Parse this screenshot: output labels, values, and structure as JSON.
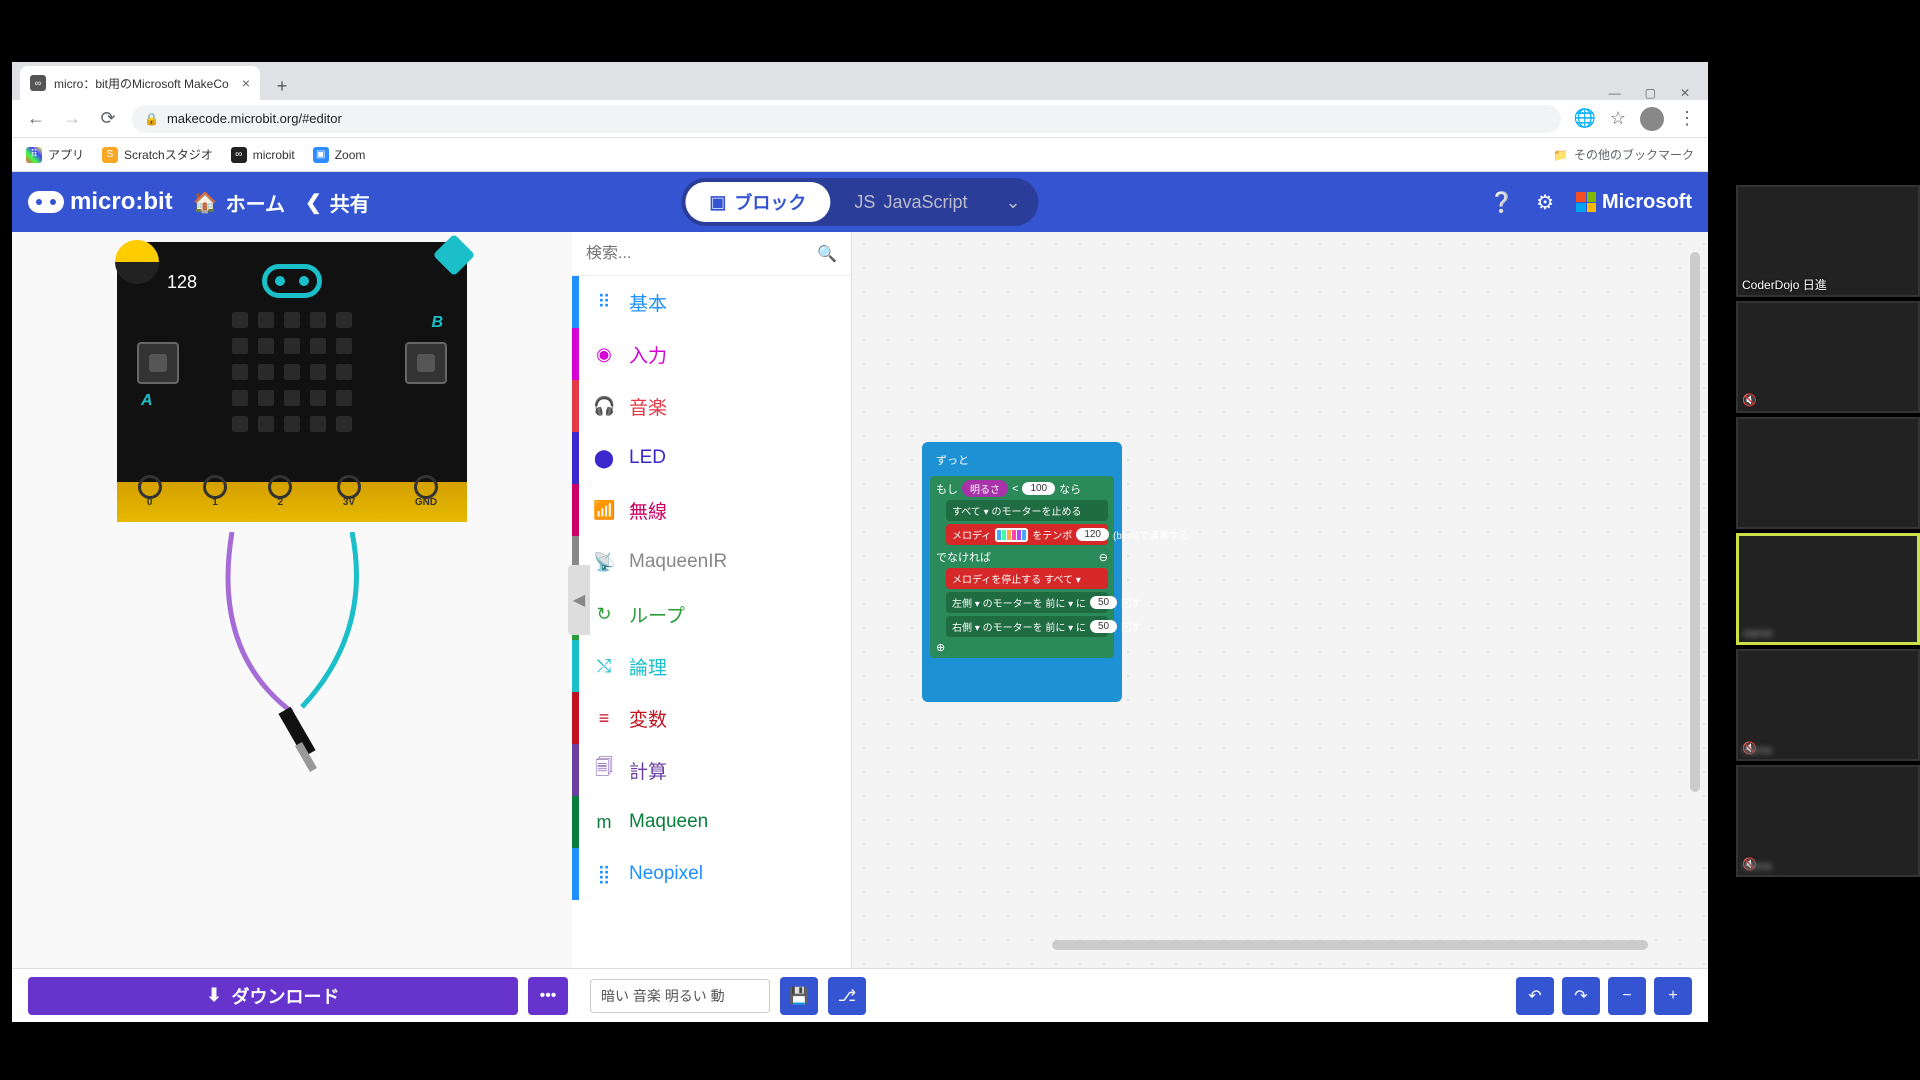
{
  "browser": {
    "tab_title": "micro：bit用のMicrosoft MakeCo",
    "url": "makecode.microbit.org/#editor",
    "bookmarks": {
      "apps": "アプリ",
      "scratch": "Scratchスタジオ",
      "microbit": "microbit",
      "zoom": "Zoom",
      "other": "その他のブックマーク"
    }
  },
  "header": {
    "logo": "micro:bit",
    "home": "ホーム",
    "share": "共有",
    "blocks": "ブロック",
    "javascript": "JavaScript",
    "ms": "Microsoft"
  },
  "sim": {
    "value": "128",
    "pins": [
      "0",
      "1",
      "2",
      "3V",
      "GND"
    ]
  },
  "search": {
    "placeholder": "検索..."
  },
  "categories": [
    {
      "label": "基本",
      "color": "#1e90ff",
      "icon": "⠿"
    },
    {
      "label": "入力",
      "color": "#d400d4",
      "icon": "◉"
    },
    {
      "label": "音楽",
      "color": "#e63946",
      "icon": "🎧"
    },
    {
      "label": "LED",
      "color": "#3b28cc",
      "icon": "⬤"
    },
    {
      "label": "無線",
      "color": "#cc0066",
      "icon": "📶"
    },
    {
      "label": "MaqueenIR",
      "color": "#888888",
      "icon": "📡"
    },
    {
      "label": "ループ",
      "color": "#2a9d3a",
      "icon": "↻"
    },
    {
      "label": "論理",
      "color": "#1bbfc9",
      "icon": "⤭"
    },
    {
      "label": "変数",
      "color": "#c1121f",
      "icon": "≡"
    },
    {
      "label": "計算",
      "color": "#6a3fa0",
      "icon": "🗐"
    },
    {
      "label": "Maqueen",
      "color": "#0a7d3d",
      "icon": "m"
    },
    {
      "label": "Neopixel",
      "color": "#1e90ff",
      "icon": "⣿"
    }
  ],
  "blocks": {
    "forever": "ずっと",
    "if": "もし",
    "light": "明るさ",
    "lt": "<",
    "threshold": "100",
    "then": "なら",
    "motor_stop": "すべて ▾ のモーターを止める",
    "melody": "メロディ",
    "tempo_at": "をテンポ",
    "tempo": "120",
    "bpm": "(bpm)で演奏する",
    "else": "でなければ",
    "melody_stop": "メロディを停止する すべて ▾",
    "motor_l": "左側 ▾ のモーターを 前に ▾ に",
    "speed_l": "50",
    "turn_l": "回す",
    "motor_r": "右側 ▾ のモーターを 前に ▾ に",
    "speed_r": "50",
    "turn_r": "回す"
  },
  "footer": {
    "download": "ダウンロード",
    "project": "暗い  音楽  明るい  動"
  },
  "zoom": {
    "p1": "CoderDojo 日進"
  }
}
